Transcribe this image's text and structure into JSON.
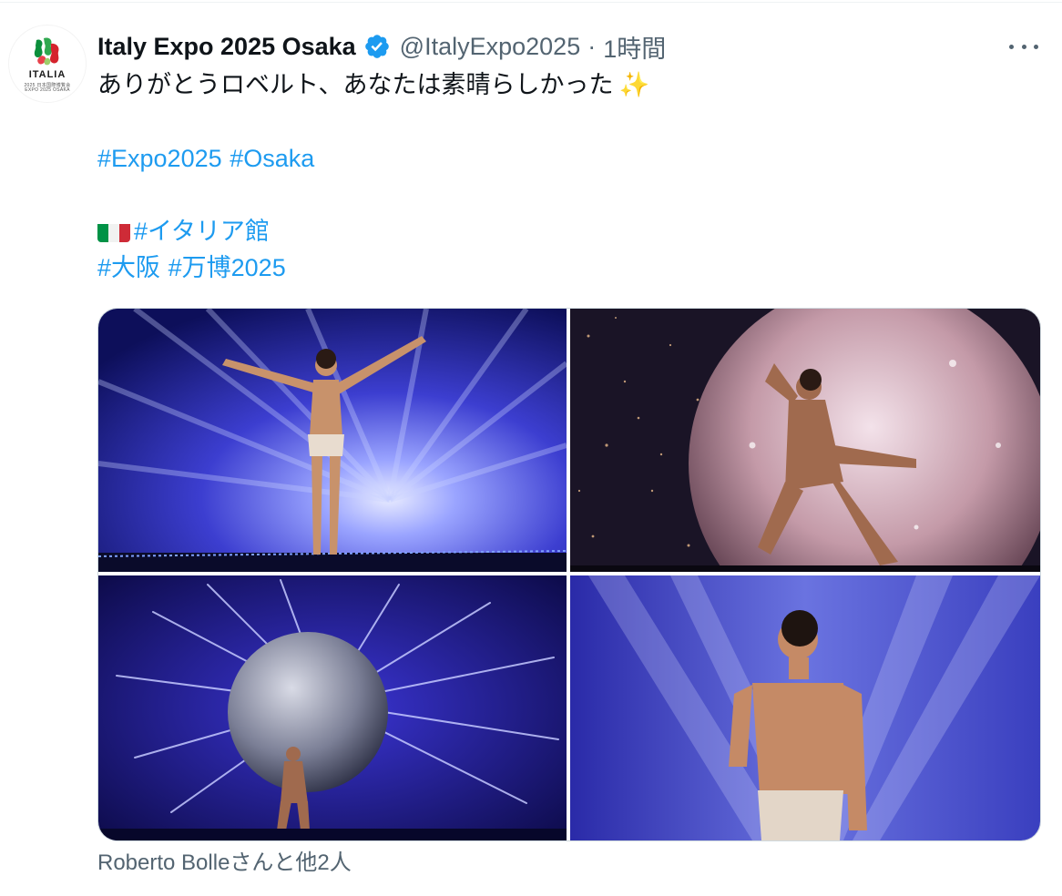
{
  "author": {
    "display_name": "Italy Expo 2025 Osaka",
    "handle": "@ItalyExpo2025",
    "separator": "·",
    "time": "1時間",
    "verified": true,
    "avatar_icon": "italia-expo-logo",
    "avatar_text": "ITALIA",
    "avatar_sub1": "2025 日本国際博覧会",
    "avatar_sub2": "EXPO 2025 OSAKA"
  },
  "tweet": {
    "text": "ありがとうロベルト、あなたは素晴らしかった",
    "emoji": "✨",
    "hashtags_line1": [
      "#Expo2025",
      "#Osaka"
    ],
    "flag_icon": "italy-flag-icon",
    "hashtags_line2": [
      "#イタリア館"
    ],
    "hashtags_line3": [
      "#大阪",
      "#万博2025"
    ]
  },
  "media": {
    "photo_count": 4,
    "photos": [
      {
        "name": "dancer-arms-raised-photo"
      },
      {
        "name": "dancer-with-moon-sphere-photo"
      },
      {
        "name": "dancer-carrying-globe-photo"
      },
      {
        "name": "dancer-hand-on-chest-photo"
      }
    ]
  },
  "tagged_people": "Roberto Bolleさんと他2人",
  "more_icon": "more-horizontal-icon",
  "colors": {
    "link": "#1d9bf0",
    "secondary_text": "#536471",
    "primary_text": "#0f1419",
    "verified": "#1d9bf0",
    "flag_green": "#009246",
    "flag_white": "#f1f2f1",
    "flag_red": "#ce2b37"
  }
}
